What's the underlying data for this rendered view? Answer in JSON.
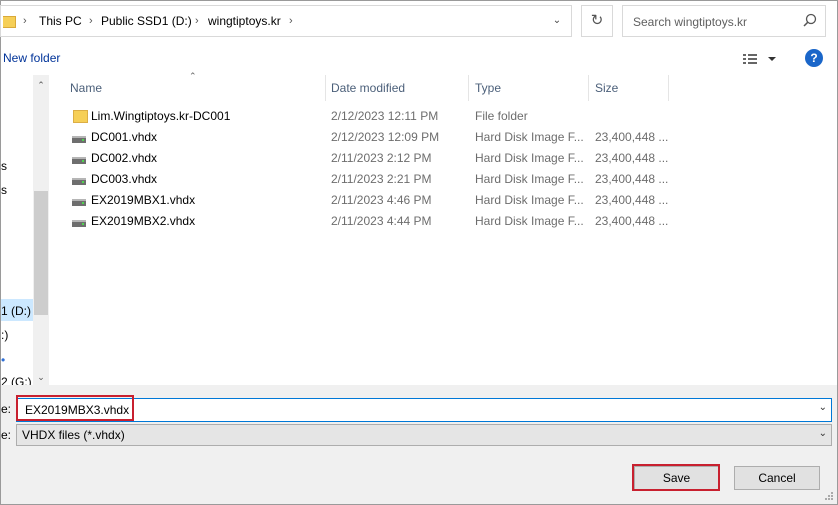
{
  "breadcrumb": [
    "This PC",
    "Public SSD1 (D:)",
    "wingtiptoys.kr"
  ],
  "search": {
    "placeholder": "Search wingtiptoys.kr"
  },
  "toolbar": {
    "new_folder": "New folder",
    "help": "?"
  },
  "nav": {
    "partial_items": [
      "s",
      "s",
      "1 (D:)",
      ":)",
      "2 (G:)"
    ],
    "selected_index": 2
  },
  "columns": {
    "name": "Name",
    "date": "Date modified",
    "type": "Type",
    "size": "Size"
  },
  "files": [
    {
      "name": "Lim.Wingtiptoys.kr-DC001",
      "date": "2/12/2023 12:11 PM",
      "type": "File folder",
      "size": "",
      "icon": "folder-icon"
    },
    {
      "name": "DC001.vhdx",
      "date": "2/12/2023 12:09 PM",
      "type": "Hard Disk Image F...",
      "size": "23,400,448 ...",
      "icon": "disk-image-icon"
    },
    {
      "name": "DC002.vhdx",
      "date": "2/11/2023 2:12 PM",
      "type": "Hard Disk Image F...",
      "size": "23,400,448 ...",
      "icon": "disk-image-icon"
    },
    {
      "name": "DC003.vhdx",
      "date": "2/11/2023 2:21 PM",
      "type": "Hard Disk Image F...",
      "size": "23,400,448 ...",
      "icon": "disk-image-icon"
    },
    {
      "name": "EX2019MBX1.vhdx",
      "date": "2/11/2023 4:46 PM",
      "type": "Hard Disk Image F...",
      "size": "23,400,448 ...",
      "icon": "disk-image-icon"
    },
    {
      "name": "EX2019MBX2.vhdx",
      "date": "2/11/2023 4:44 PM",
      "type": "Hard Disk Image F...",
      "size": "23,400,448 ...",
      "icon": "disk-image-icon"
    }
  ],
  "filename": {
    "label": "e:",
    "value": "EX2019MBX3.vhdx"
  },
  "filetype": {
    "label": "e:",
    "value": "VHDX files (*.vhdx)"
  },
  "buttons": {
    "save": "Save",
    "cancel": "Cancel"
  },
  "colors": {
    "highlight": "#c8202f",
    "accent": "#0078d7",
    "selection": "#cce8ff"
  }
}
